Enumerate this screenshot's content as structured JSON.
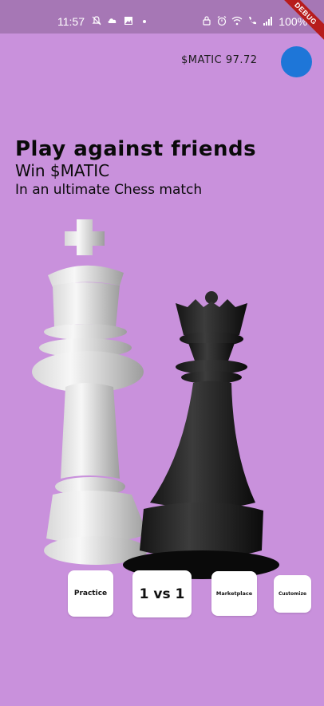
{
  "status_bar": {
    "time": "11:57",
    "battery": "100%"
  },
  "debug_banner": "DEBUG",
  "wallet": {
    "balance": "$MATIC 97.72"
  },
  "hero": {
    "title": "Play against friends",
    "subtitle": "Win $MATIC",
    "tagline": "In an ultimate Chess match"
  },
  "menu": {
    "practice": "Practice",
    "one_vs_one": "1 vs 1",
    "marketplace": "Marketplace",
    "customize": "Customize"
  },
  "colors": {
    "background": "#c991dc",
    "status_bar": "#a677b5",
    "avatar": "#1e76d8",
    "card": "#ffffff",
    "ribbon": "#b71c1c"
  }
}
